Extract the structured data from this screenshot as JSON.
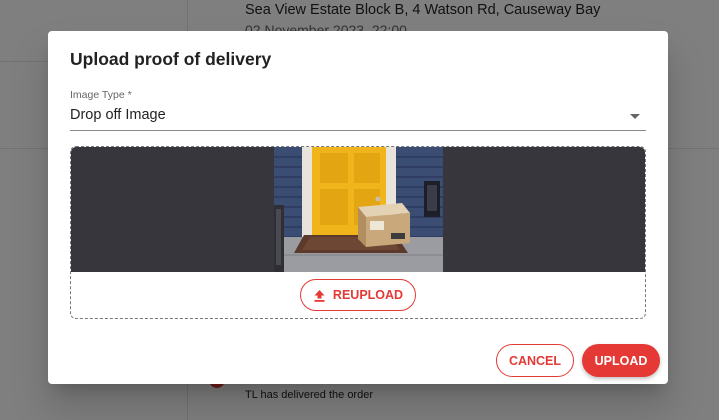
{
  "background": {
    "address": "Sea View Estate Block B, 4 Watson Rd, Causeway Bay",
    "date": "02 November 2023, 22:00",
    "event": "TL has delivered the order"
  },
  "dialog": {
    "title": "Upload proof of delivery",
    "image_type": {
      "label": "Image Type *",
      "value": "Drop off Image"
    },
    "photo_icon": "delivered-package-photo",
    "reupload_label": "REUPLOAD",
    "reupload_icon": "upload-icon",
    "cancel_label": "CANCEL",
    "upload_label": "UPLOAD"
  },
  "colors": {
    "accent": "#e53935",
    "preview_bg": "#36363c"
  }
}
